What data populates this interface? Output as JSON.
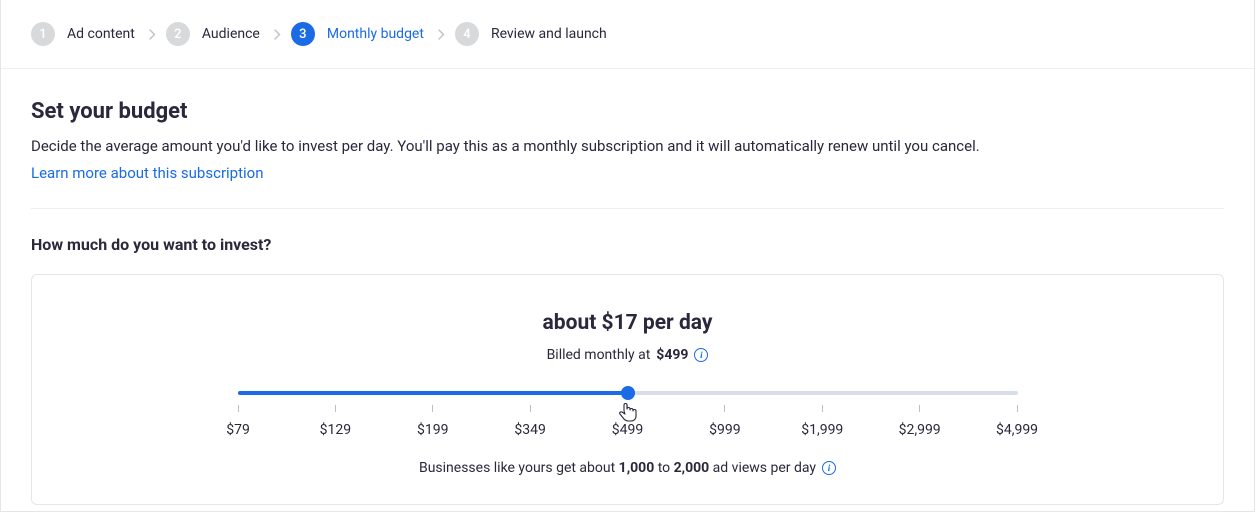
{
  "stepper": {
    "steps": [
      {
        "num": "1",
        "label": "Ad content",
        "active": false
      },
      {
        "num": "2",
        "label": "Audience",
        "active": false
      },
      {
        "num": "3",
        "label": "Monthly budget",
        "active": true
      },
      {
        "num": "4",
        "label": "Review and launch",
        "active": false
      }
    ]
  },
  "header": {
    "title": "Set your budget",
    "subtitle": "Decide the average amount you'd like to invest per day. You'll pay this as a monthly subscription and it will automatically renew until you cancel.",
    "link_label": "Learn more about this subscription"
  },
  "question": "How much do you want to invest?",
  "budget": {
    "per_day": "about $17 per day",
    "billed_prefix": "Billed monthly at ",
    "billed_amount": "$499",
    "selected_index": 4,
    "ticks": [
      "$79",
      "$129",
      "$199",
      "$349",
      "$499",
      "$999",
      "$1,999",
      "$2,999",
      "$4,999"
    ],
    "hint_p1": "Businesses like yours get about ",
    "hint_low": "1,000",
    "hint_to": " to ",
    "hint_high": "2,000",
    "hint_p2": " ad views per day"
  }
}
